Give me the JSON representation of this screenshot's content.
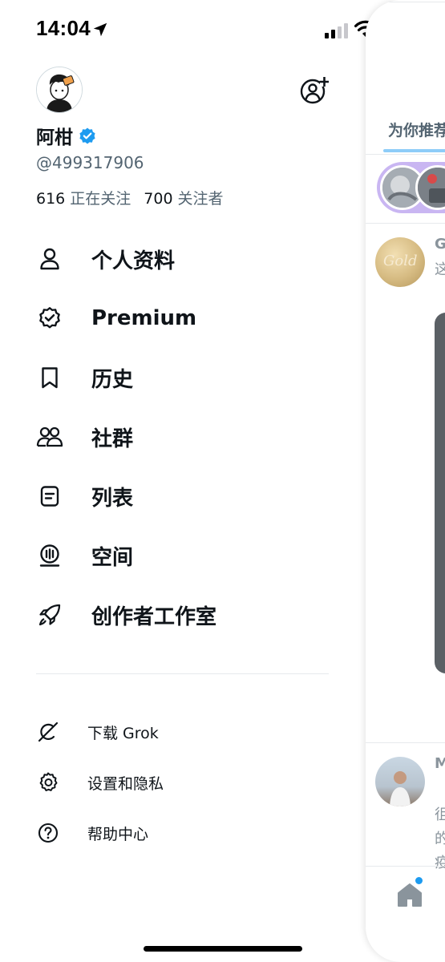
{
  "status_bar": {
    "time": "14:04",
    "icons": [
      "location-arrow-icon",
      "cellular-signal-icon",
      "wifi-icon",
      "battery-icon"
    ]
  },
  "profile": {
    "name": "阿柑",
    "handle": "@499317906",
    "following_count": "616",
    "following_label": "正在关注",
    "followers_count": "700",
    "followers_label": "关注者",
    "verified": true
  },
  "menu": {
    "items": [
      {
        "label": "个人资料",
        "icon": "person-icon"
      },
      {
        "label": "Premium",
        "icon": "verified-badge-icon"
      },
      {
        "label": "历史",
        "icon": "bookmark-icon"
      },
      {
        "label": "社群",
        "icon": "community-icon"
      },
      {
        "label": "列表",
        "icon": "list-icon"
      },
      {
        "label": "空间",
        "icon": "spaces-icon"
      },
      {
        "label": "创作者工作室",
        "icon": "rocket-icon"
      }
    ],
    "secondary": [
      {
        "label": "下载 Grok",
        "icon": "grok-icon"
      },
      {
        "label": "设置和隐私",
        "icon": "gear-icon"
      },
      {
        "label": "帮助中心",
        "icon": "help-icon"
      }
    ]
  },
  "peek": {
    "tab_label": "为你推荐",
    "gold_text": "Gold",
    "post1_name": "G",
    "post1_line": "这",
    "post2_name": "M",
    "post2_lines": [
      "徂",
      "的",
      "疫"
    ]
  },
  "colors": {
    "brand": "#1d9bf0",
    "text": "#0f1419",
    "secondary_text": "#536471"
  }
}
